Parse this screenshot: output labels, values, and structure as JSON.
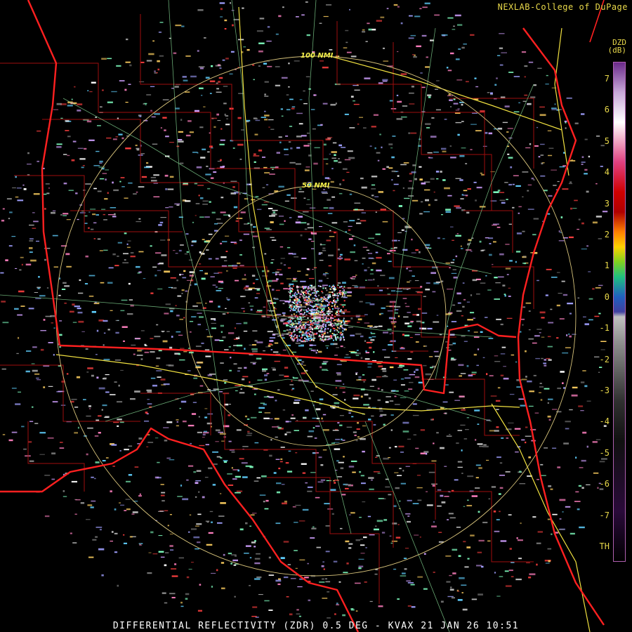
{
  "credit": "NEXLAB-College of DuPage",
  "footer": "DIFFERENTIAL REFLECTIVITY (ZDR) 0.5 DEG - KVAX 21 JAN 26 10:51",
  "legend": {
    "product": "DZD",
    "unit": "(dB)",
    "ticks": [
      "7",
      "6",
      "5",
      "4",
      "3",
      "2",
      "1",
      "0",
      "-1",
      "-2",
      "-3",
      "-4",
      "-5",
      "-6",
      "-7",
      "TH"
    ]
  },
  "range_rings": [
    "50 NMI",
    "100 NMI"
  ],
  "colors": {
    "state_border": "#ff2020",
    "county_border": "#b01010",
    "highway": "#f0e040",
    "road": "#8be09a",
    "ring": "#d6c27a",
    "text": "#e8d84a"
  }
}
